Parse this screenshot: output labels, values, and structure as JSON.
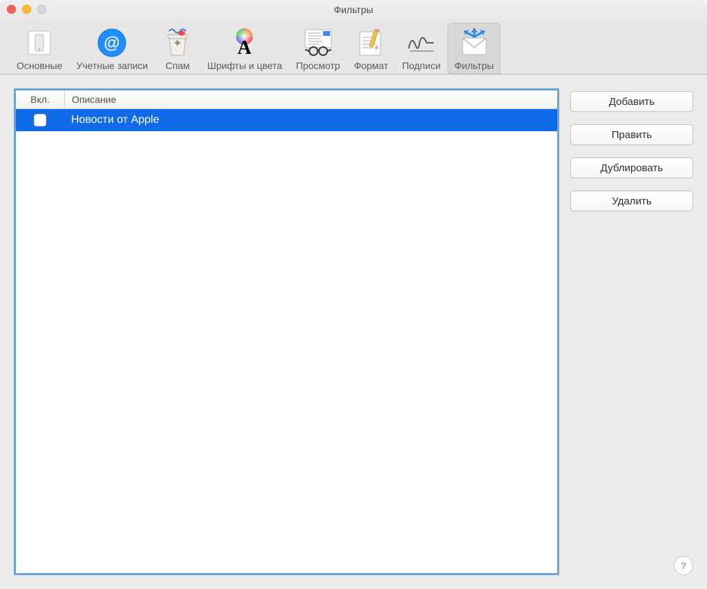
{
  "window": {
    "title": "Фильтры"
  },
  "toolbar": {
    "items": [
      {
        "id": "general",
        "label": "Основные"
      },
      {
        "id": "accounts",
        "label": "Учетные записи"
      },
      {
        "id": "junk",
        "label": "Спам"
      },
      {
        "id": "fonts",
        "label": "Шрифты и цвета"
      },
      {
        "id": "viewing",
        "label": "Просмотр"
      },
      {
        "id": "composing",
        "label": "Формат"
      },
      {
        "id": "signatures",
        "label": "Подписи"
      },
      {
        "id": "rules",
        "label": "Фильтры"
      }
    ],
    "selected": "rules"
  },
  "list": {
    "columns": {
      "enabled": "Вкл.",
      "description": "Описание"
    },
    "rows": [
      {
        "enabled": false,
        "description": "Новости от Apple",
        "selected": true
      }
    ]
  },
  "buttons": {
    "add": "Добавить",
    "edit": "Править",
    "duplicate": "Дублировать",
    "remove": "Удалить"
  },
  "help_glyph": "?"
}
